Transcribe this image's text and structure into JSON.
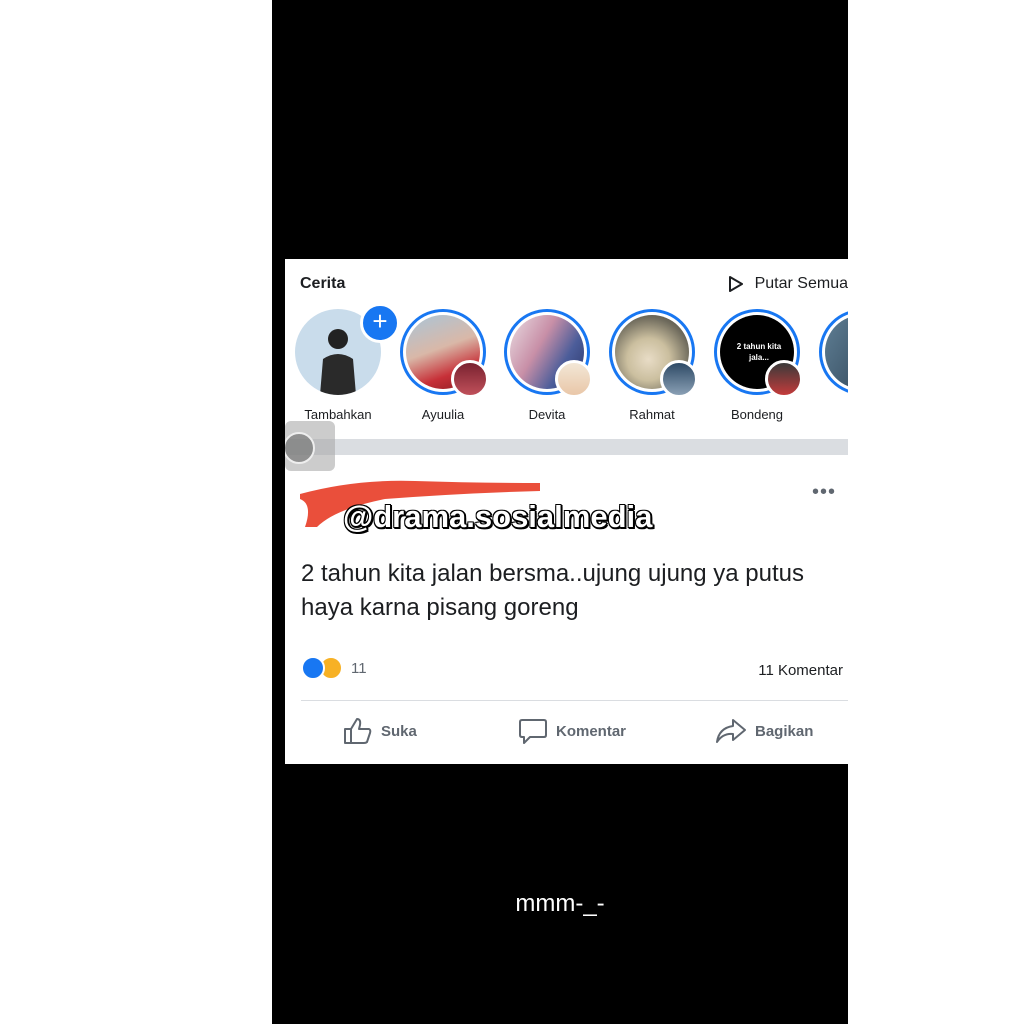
{
  "stories": {
    "title": "Cerita",
    "play_all": "Putar Semua",
    "items": [
      {
        "name": "Tambahkan"
      },
      {
        "name": "Ayuulia"
      },
      {
        "name": "Devita"
      },
      {
        "name": "Rahmat"
      },
      {
        "name": "Bondeng",
        "preview_text": "2 tahun kita jala..."
      }
    ]
  },
  "post": {
    "watermark": "@drama.sosialmedia",
    "text": "2 tahun kita jalan bersma..ujung ujung ya putus haya karna pisang goreng",
    "reaction_count": "11",
    "comment_count": "11 Komentar",
    "actions": {
      "like": "Suka",
      "comment": "Komentar",
      "share": "Bagikan"
    }
  },
  "caption": "mmm-_-",
  "colors": {
    "accent": "#1877f2",
    "redaction": "#e8402a",
    "background_panel": "#000000"
  }
}
